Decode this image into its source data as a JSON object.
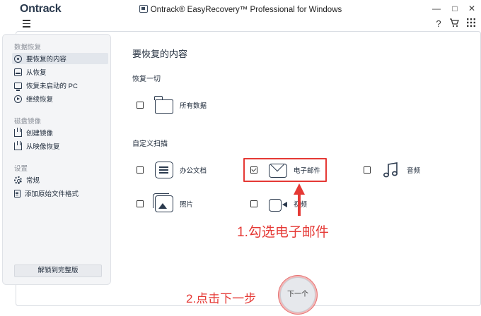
{
  "window": {
    "logo": "Ontrack",
    "title": "Ontrack® EasyRecovery™ Professional for Windows",
    "controls": {
      "minimize": "—",
      "maximize": "□",
      "close": "✕"
    }
  },
  "toolbar": {
    "help": "?",
    "cart": "🛒",
    "apps": "⋮⋮"
  },
  "sidebar": {
    "sections": [
      {
        "title": "数据恢复",
        "items": [
          {
            "label": "要恢复的内容",
            "icon": "target-icon",
            "active": true
          },
          {
            "label": "从恢复",
            "icon": "drive-icon"
          },
          {
            "label": "恢复未启动的 PC",
            "icon": "monitor-icon"
          },
          {
            "label": "继续恢复",
            "icon": "resume-icon"
          }
        ]
      },
      {
        "title": "磁盘镜像",
        "items": [
          {
            "label": "创建镜像",
            "icon": "create-image-icon"
          },
          {
            "label": "从映像恢复",
            "icon": "restore-image-icon"
          }
        ]
      },
      {
        "title": "设置",
        "items": [
          {
            "label": "常规",
            "icon": "gear-icon"
          },
          {
            "label": "添加原始文件格式",
            "icon": "file-format-icon"
          }
        ]
      }
    ],
    "unlock_button": "解锁到完整版"
  },
  "content": {
    "title": "要恢复的内容",
    "recover_all": {
      "label": "恢复一切",
      "options": [
        {
          "label": "所有数据",
          "icon": "folder-icon",
          "checked": false
        }
      ]
    },
    "custom_scan": {
      "label": "自定义扫描",
      "options": [
        {
          "label": "办公文档",
          "icon": "document-icon",
          "checked": false
        },
        {
          "label": "电子邮件",
          "icon": "email-icon",
          "checked": true
        },
        {
          "label": "音频",
          "icon": "music-icon",
          "checked": false
        },
        {
          "label": "照片",
          "icon": "photo-icon",
          "checked": false
        },
        {
          "label": "视频",
          "icon": "video-icon",
          "checked": false
        }
      ]
    },
    "next_button": "下一个"
  },
  "annotations": {
    "step1": "1.勾选电子邮件",
    "step2": "2.点击下一步",
    "color": "#e53935"
  }
}
